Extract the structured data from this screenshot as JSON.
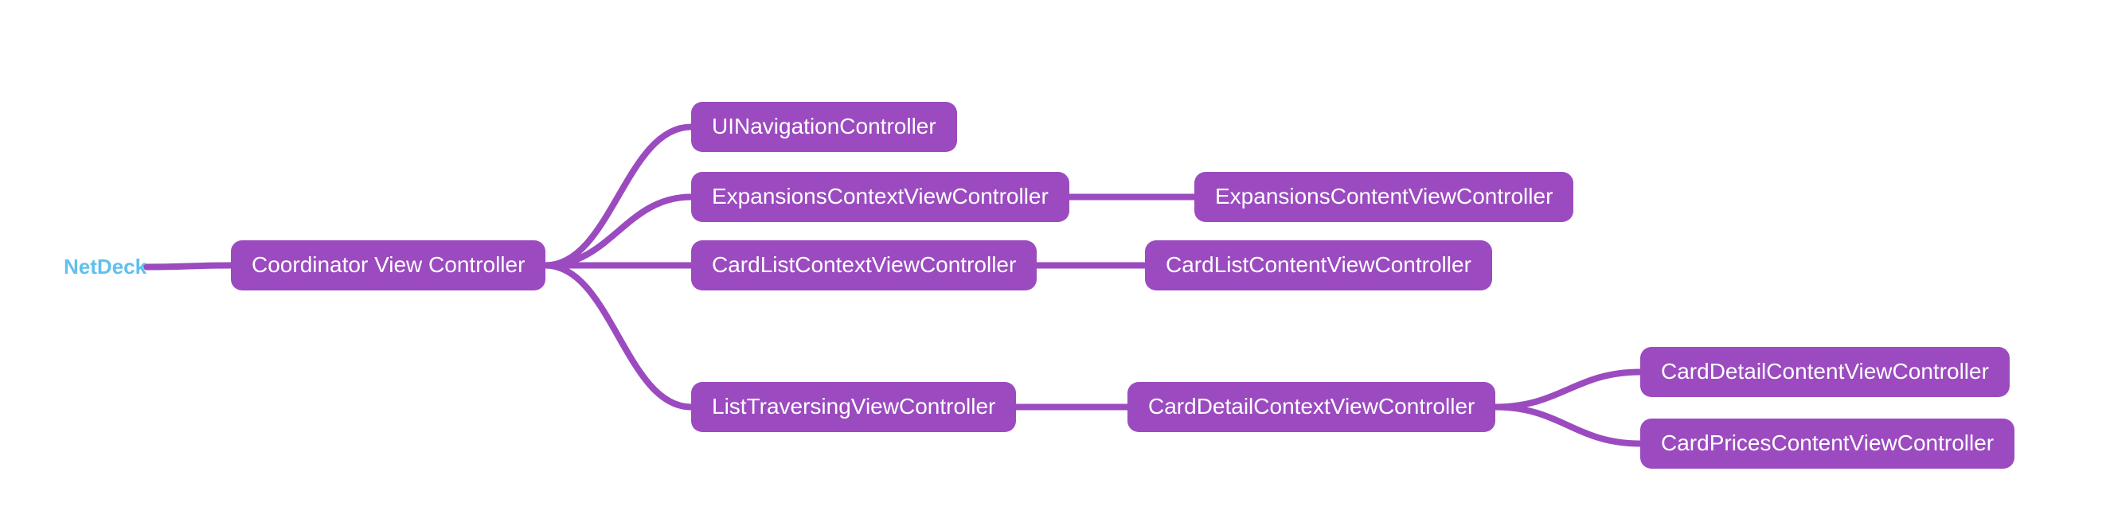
{
  "colors": {
    "node_fill": "#9b4bbf",
    "node_text": "#ffffff",
    "edge": "#9b4bbf",
    "root_text": "#62c0ea",
    "background": "#ffffff"
  },
  "root": {
    "label": "NetDeck"
  },
  "nodes": {
    "coordinator": "Coordinator View Controller",
    "uinav": "UINavigationController",
    "exp_ctx": "ExpansionsContextViewController",
    "exp_content": "ExpansionsContentViewController",
    "cardlist_ctx": "CardListContextViewController",
    "cardlist_content": "CardListContentViewController",
    "list_trav": "ListTraversingViewController",
    "carddetail_ctx": "CardDetailContextViewController",
    "carddetail_content": "CardDetailContentViewController",
    "cardprices_content": "CardPricesContentViewController"
  },
  "edges": [
    [
      "root",
      "coordinator"
    ],
    [
      "coordinator",
      "uinav"
    ],
    [
      "coordinator",
      "exp_ctx"
    ],
    [
      "coordinator",
      "cardlist_ctx"
    ],
    [
      "coordinator",
      "list_trav"
    ],
    [
      "exp_ctx",
      "exp_content"
    ],
    [
      "cardlist_ctx",
      "cardlist_content"
    ],
    [
      "list_trav",
      "carddetail_ctx"
    ],
    [
      "carddetail_ctx",
      "carddetail_content"
    ],
    [
      "carddetail_ctx",
      "cardprices_content"
    ]
  ]
}
